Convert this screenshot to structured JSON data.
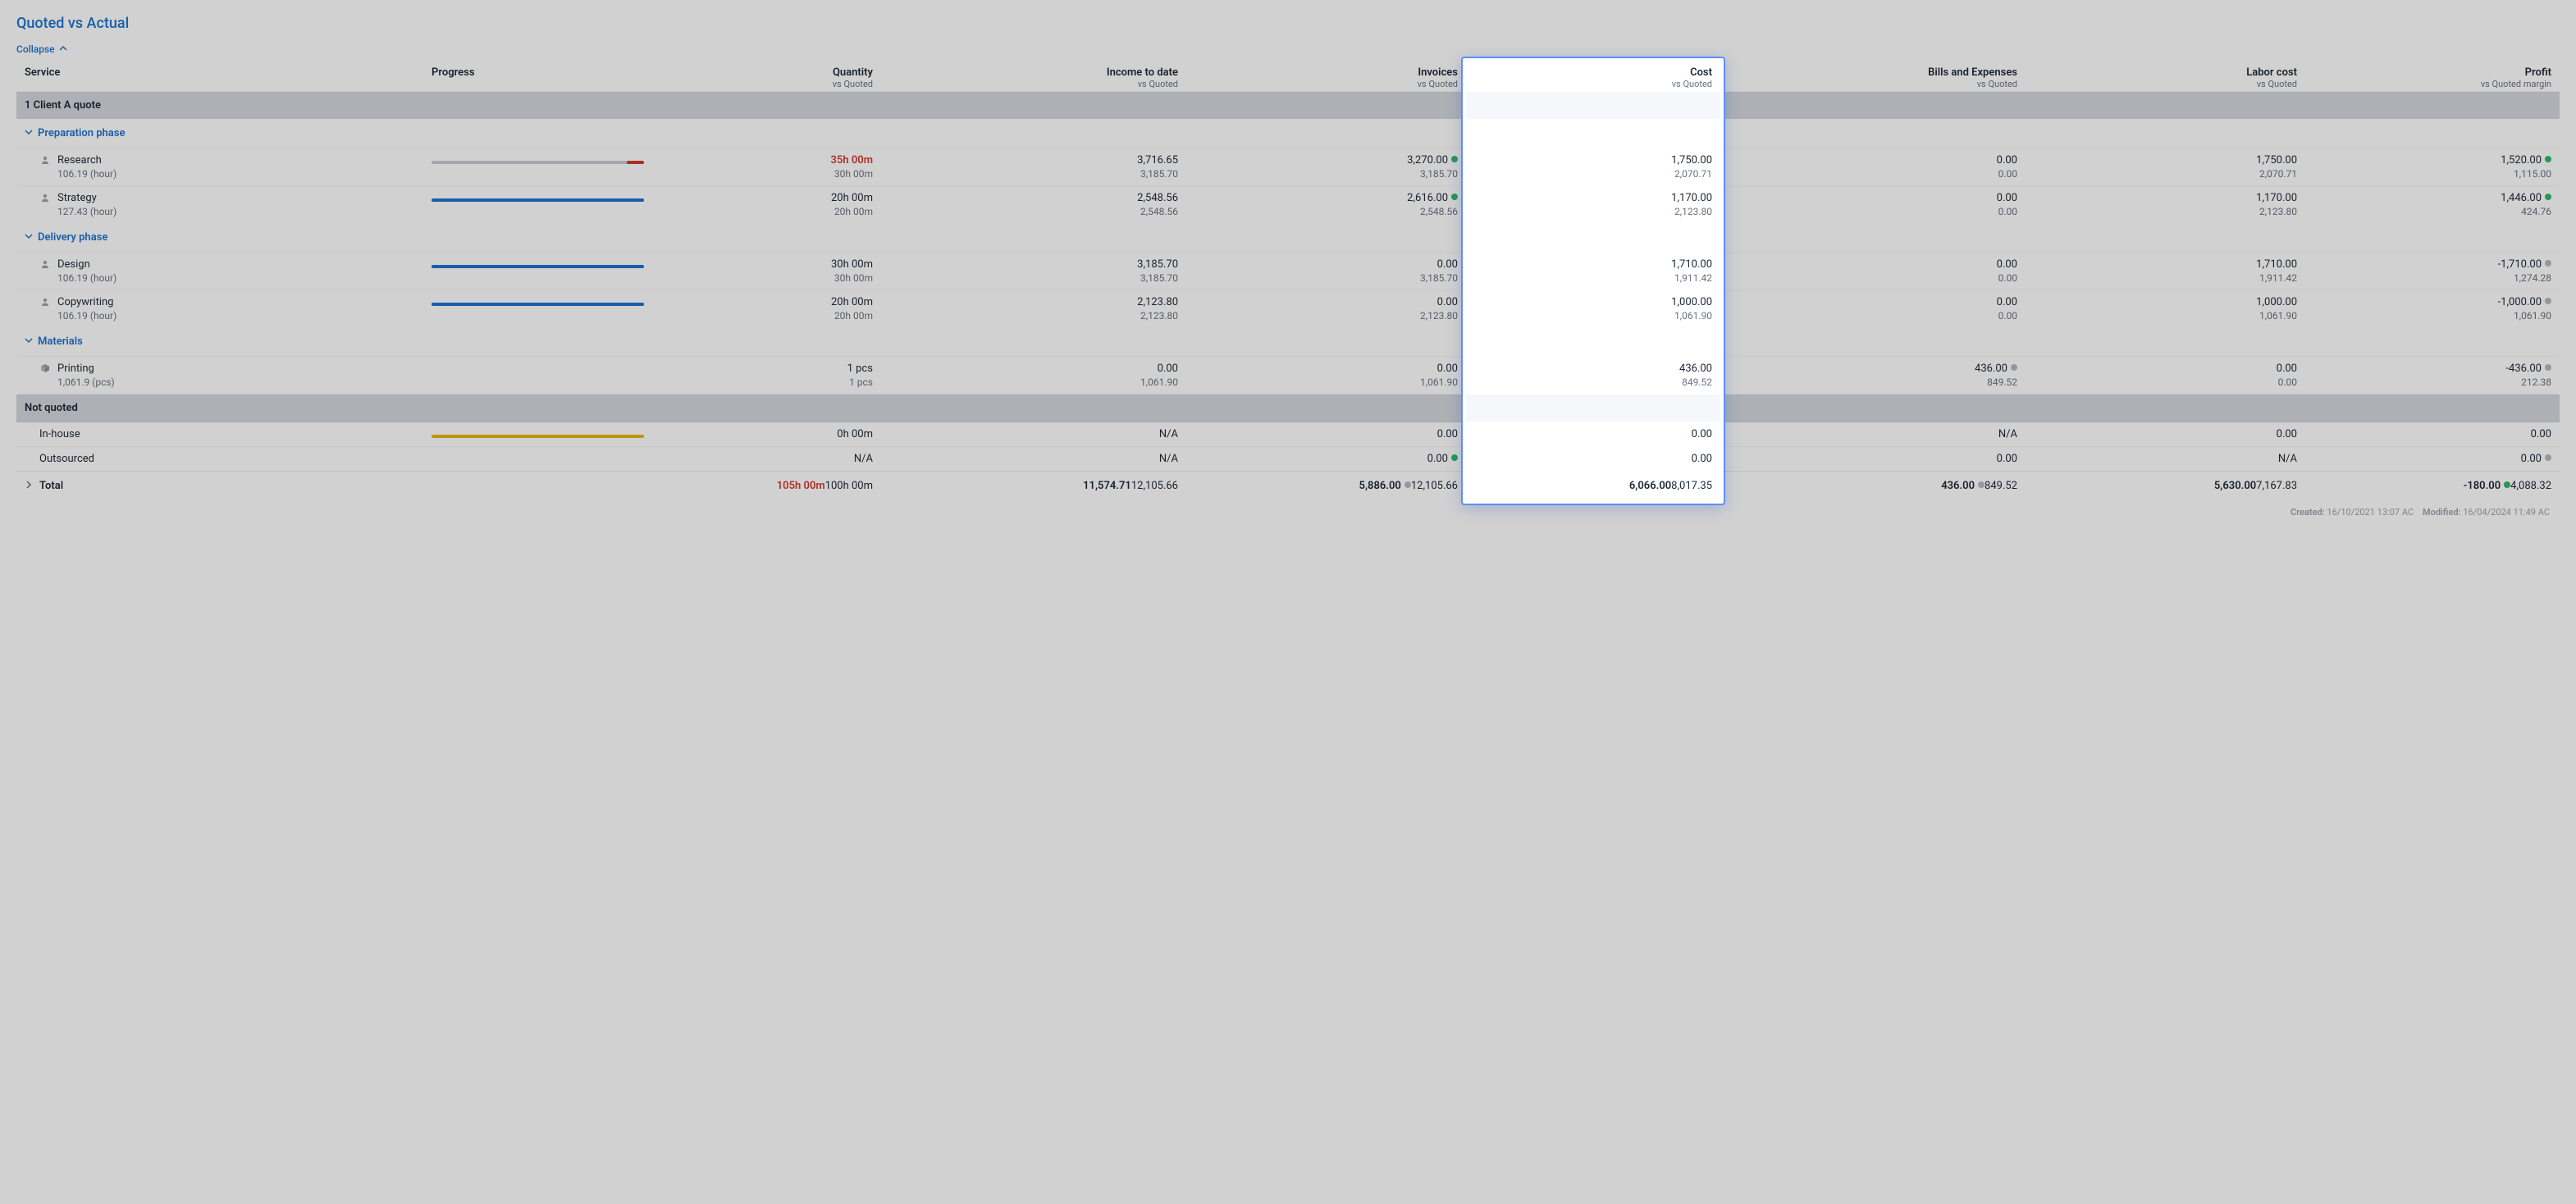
{
  "title": "Quoted vs Actual",
  "collapse_label": "Collapse",
  "columns": {
    "service": "Service",
    "progress": "Progress",
    "quantity": {
      "label": "Quantity",
      "sub": "vs Quoted"
    },
    "income": {
      "label": "Income to date",
      "sub": "vs Quoted"
    },
    "invoices": {
      "label": "Invoices",
      "sub": "vs Quoted"
    },
    "cost": {
      "label": "Cost",
      "sub": "vs Quoted"
    },
    "bills": {
      "label": "Bills and Expenses",
      "sub": "vs Quoted"
    },
    "labor": {
      "label": "Labor cost",
      "sub": "vs Quoted"
    },
    "profit": {
      "label": "Profit",
      "sub": "vs Quoted margin"
    }
  },
  "sections": [
    {
      "type": "head",
      "label": "1 Client A quote"
    },
    {
      "type": "phase",
      "label": "Preparation phase"
    },
    {
      "type": "row",
      "icon": "person",
      "name": "Research",
      "subname": "106.19 (hour)",
      "progress": {
        "color": "grey",
        "pct": 100,
        "tail_color": "red",
        "tail_pct": 8
      },
      "quantity": {
        "v": "35h 00m",
        "s": "30h 00m",
        "red": true
      },
      "income": {
        "v": "3,716.65",
        "s": "3,185.70"
      },
      "invoices": {
        "v": "3,270.00",
        "s": "3,185.70",
        "dot": "green"
      },
      "cost": {
        "v": "1,750.00",
        "s": "2,070.71"
      },
      "bills": {
        "v": "0.00",
        "s": "0.00"
      },
      "labor": {
        "v": "1,750.00",
        "s": "2,070.71"
      },
      "profit": {
        "v": "1,520.00",
        "s": "1,115.00",
        "dot": "green"
      }
    },
    {
      "type": "row",
      "icon": "person",
      "name": "Strategy",
      "subname": "127.43 (hour)",
      "progress": {
        "color": "blue",
        "pct": 100
      },
      "quantity": {
        "v": "20h 00m",
        "s": "20h 00m"
      },
      "income": {
        "v": "2,548.56",
        "s": "2,548.56"
      },
      "invoices": {
        "v": "2,616.00",
        "s": "2,548.56",
        "dot": "green"
      },
      "cost": {
        "v": "1,170.00",
        "s": "2,123.80"
      },
      "bills": {
        "v": "0.00",
        "s": "0.00"
      },
      "labor": {
        "v": "1,170.00",
        "s": "2,123.80"
      },
      "profit": {
        "v": "1,446.00",
        "s": "424.76",
        "dot": "green"
      }
    },
    {
      "type": "phase",
      "label": "Delivery phase"
    },
    {
      "type": "row",
      "icon": "person",
      "name": "Design",
      "subname": "106.19 (hour)",
      "progress": {
        "color": "blue",
        "pct": 100
      },
      "quantity": {
        "v": "30h 00m",
        "s": "30h 00m"
      },
      "income": {
        "v": "3,185.70",
        "s": "3,185.70"
      },
      "invoices": {
        "v": "0.00",
        "s": "3,185.70"
      },
      "cost": {
        "v": "1,710.00",
        "s": "1,911.42"
      },
      "bills": {
        "v": "0.00",
        "s": "0.00"
      },
      "labor": {
        "v": "1,710.00",
        "s": "1,911.42"
      },
      "profit": {
        "v": "-1,710.00",
        "s": "1,274.28",
        "dot": "grey"
      }
    },
    {
      "type": "row",
      "icon": "person",
      "name": "Copywriting",
      "subname": "106.19 (hour)",
      "progress": {
        "color": "blue",
        "pct": 100
      },
      "quantity": {
        "v": "20h 00m",
        "s": "20h 00m"
      },
      "income": {
        "v": "2,123.80",
        "s": "2,123.80"
      },
      "invoices": {
        "v": "0.00",
        "s": "2,123.80"
      },
      "cost": {
        "v": "1,000.00",
        "s": "1,061.90"
      },
      "bills": {
        "v": "0.00",
        "s": "0.00"
      },
      "labor": {
        "v": "1,000.00",
        "s": "1,061.90"
      },
      "profit": {
        "v": "-1,000.00",
        "s": "1,061.90",
        "dot": "grey"
      }
    },
    {
      "type": "phase",
      "label": "Materials"
    },
    {
      "type": "row",
      "icon": "box",
      "name": "Printing",
      "subname": "1,061.9 (pcs)",
      "progress": null,
      "quantity": {
        "v": "1 pcs",
        "s": "1 pcs"
      },
      "income": {
        "v": "0.00",
        "s": "1,061.90"
      },
      "invoices": {
        "v": "0.00",
        "s": "1,061.90"
      },
      "cost": {
        "v": "436.00",
        "s": "849.52"
      },
      "bills": {
        "v": "436.00",
        "s": "849.52",
        "dot": "grey"
      },
      "labor": {
        "v": "0.00",
        "s": "0.00"
      },
      "profit": {
        "v": "-436.00",
        "s": "212.38",
        "dot": "grey"
      }
    },
    {
      "type": "head",
      "label": "Not quoted"
    },
    {
      "type": "simple",
      "name": "In-house",
      "progress": {
        "color": "yellow",
        "pct": 100
      },
      "quantity": {
        "v": "0h 00m"
      },
      "income": {
        "v": "N/A"
      },
      "invoices": {
        "v": "0.00"
      },
      "cost": {
        "v": "0.00"
      },
      "bills": {
        "v": "N/A"
      },
      "labor": {
        "v": "0.00"
      },
      "profit": {
        "v": "0.00"
      }
    },
    {
      "type": "simple",
      "name": "Outsourced",
      "progress": null,
      "quantity": {
        "v": "N/A"
      },
      "income": {
        "v": "N/A"
      },
      "invoices": {
        "v": "0.00",
        "dot": "green"
      },
      "cost": {
        "v": "0.00"
      },
      "bills": {
        "v": "0.00"
      },
      "labor": {
        "v": "N/A"
      },
      "profit": {
        "v": "0.00",
        "dot": "grey"
      }
    }
  ],
  "total": {
    "label": "Total",
    "quantity": {
      "v": "105h 00m",
      "s": "100h 00m",
      "red": true
    },
    "income": {
      "v": "11,574.71",
      "s": "12,105.66"
    },
    "invoices": {
      "v": "5,886.00",
      "s": "12,105.66",
      "dot": "grey"
    },
    "cost": {
      "v": "6,066.00",
      "s": "8,017.35"
    },
    "bills": {
      "v": "436.00",
      "s": "849.52",
      "dot": "grey"
    },
    "labor": {
      "v": "5,630.00",
      "s": "7,167.83"
    },
    "profit": {
      "v": "-180.00",
      "s": "4,088.32",
      "dot": "green"
    }
  },
  "meta": {
    "created_label": "Created:",
    "created_value": "16/10/2021 13:07 AC",
    "modified_label": "Modified:",
    "modified_value": "16/04/2024 11:49 AC"
  }
}
